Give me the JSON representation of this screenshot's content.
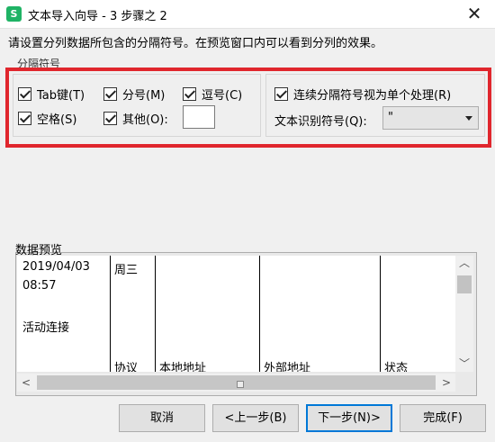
{
  "window": {
    "app_icon": "S",
    "title": "文本导入向导 - 3 步骤之 2",
    "close_glyph": "✕"
  },
  "instruction": "请设置分列数据所包含的分隔符号。在预览窗口内可以看到分列的效果。",
  "separators": {
    "group_label": "分隔符号",
    "tab": {
      "label": "Tab键(T)",
      "checked": true
    },
    "semicolon": {
      "label": "分号(M)",
      "checked": true
    },
    "comma": {
      "label": "逗号(C)",
      "checked": true
    },
    "space": {
      "label": "空格(S)",
      "checked": true
    },
    "other": {
      "label": "其他(O):",
      "checked": true,
      "value": ""
    }
  },
  "options": {
    "consecutive": {
      "label": "连续分隔符号视为单个处理(R)",
      "checked": true
    },
    "qualifier_label": "文本识别符号(Q):",
    "qualifier_value": "\""
  },
  "preview": {
    "label": "数据预览",
    "cells": {
      "c1_line1": "2019/04/03",
      "c1_line2": "08:57",
      "c1_line3": "活动连接",
      "c2_line1": "周三",
      "c2_line2": "协议",
      "c3_line1": "本地地址",
      "c4_line1": "外部地址",
      "c5_line1": "状态"
    }
  },
  "scrollbars": {
    "up_glyph": "︿",
    "down_glyph": "﹀",
    "left_glyph": "<",
    "right_glyph": ">"
  },
  "buttons": {
    "cancel": "取消",
    "back": "<上一步(B)",
    "next": "下一步(N)>",
    "finish": "完成(F)"
  },
  "colors": {
    "highlight": "#e0262d",
    "focus": "#0078d7",
    "app_icon": "#1fb365"
  }
}
